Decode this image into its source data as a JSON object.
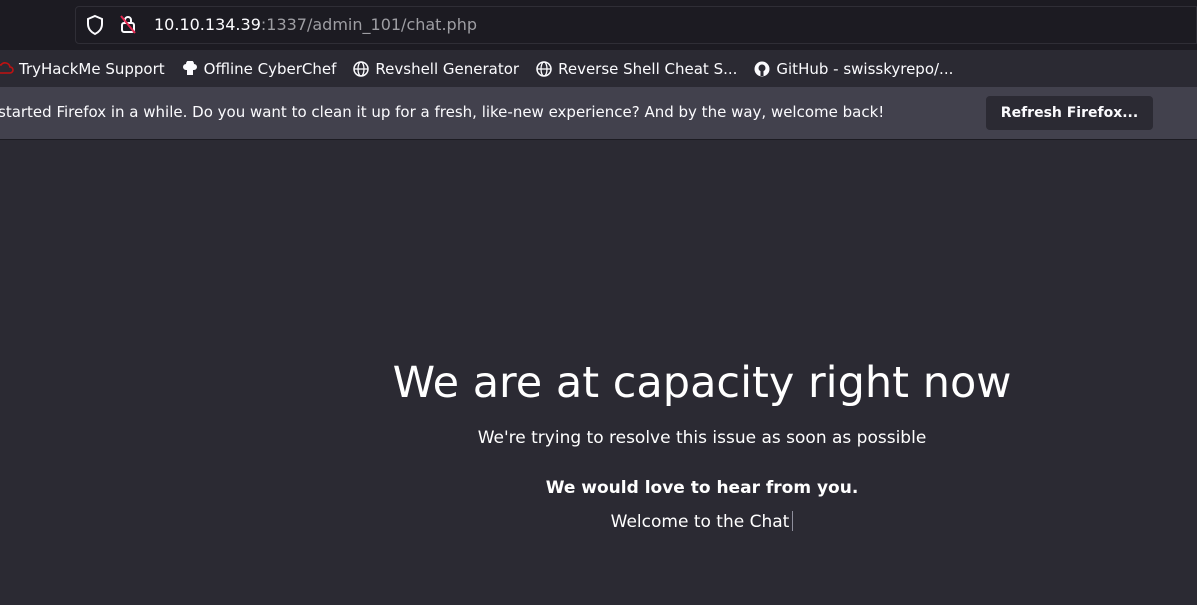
{
  "browser": {
    "url_host": "10.10.134.39",
    "url_rest": ":1337/admin_101/chat.php",
    "bookmarks": [
      {
        "label": "TryHackMe Support",
        "icon": "tryhackme-icon"
      },
      {
        "label": "Offline CyberChef",
        "icon": "chef-hat-icon"
      },
      {
        "label": "Revshell Generator",
        "icon": "globe-icon"
      },
      {
        "label": "Reverse Shell Cheat S...",
        "icon": "globe-icon"
      },
      {
        "label": "GitHub - swisskyrepo/...",
        "icon": "github-icon"
      }
    ],
    "notification_text": "started Firefox in a while. Do you want to clean it up for a fresh, like-new experience? And by the way, welcome back!",
    "refresh_button": "Refresh Firefox..."
  },
  "page": {
    "headline": "We are at capacity right now",
    "subtext": "We're trying to resolve this issue as soon as possible",
    "love_text": "We would love to hear from you.",
    "welcome_text": "Welcome to the Chat"
  },
  "colors": {
    "page_bg": "#2b2a33",
    "toolbar_bg": "#1c1b22",
    "notification_bg": "#42414d"
  }
}
